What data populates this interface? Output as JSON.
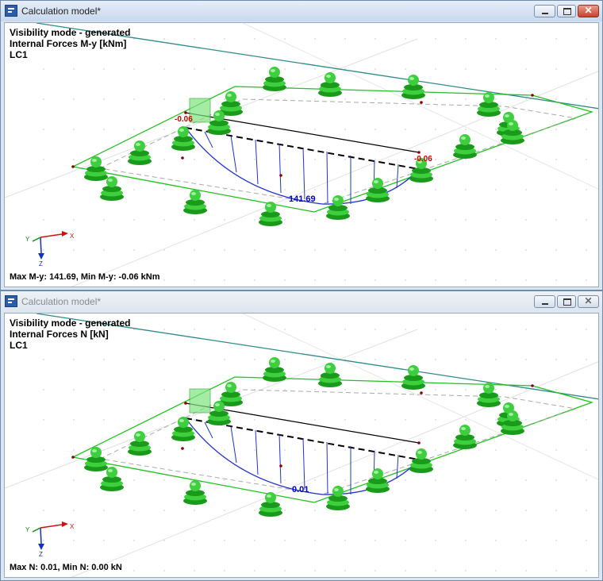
{
  "windows": [
    {
      "title": "Calculation model*",
      "info": {
        "visibility": "Visibility mode - generated",
        "forces": "Internal Forces M-y [kNm]",
        "load_case": "LC1"
      },
      "labels": {
        "left": "-0.06",
        "right": "-0.06",
        "max": "141.69"
      },
      "status": "Max M-y: 141.69, Min M-y: -0.06  kNm",
      "axis": {
        "x": "X",
        "y": "Y",
        "z": "Z"
      },
      "close_symbol": "✕"
    },
    {
      "title": "Calculation model*",
      "info": {
        "visibility": "Visibility mode - generated",
        "forces": "Internal Forces N [kN]",
        "load_case": "LC1"
      },
      "labels": {
        "max": "0.01"
      },
      "status": "Max N: 0.01, Min N: 0.00  kN",
      "axis": {
        "x": "X",
        "y": "Y",
        "z": "Z"
      },
      "close_symbol": "✕"
    }
  ],
  "colors": {
    "support": "#3dcf3d",
    "support_dark": "#1a9a1a",
    "slab_edge": "#22c022",
    "diagram": "#2233cc",
    "label_red": "#cc0000",
    "label_blue": "#0000cc",
    "teal_line": "#2f8a8a"
  }
}
